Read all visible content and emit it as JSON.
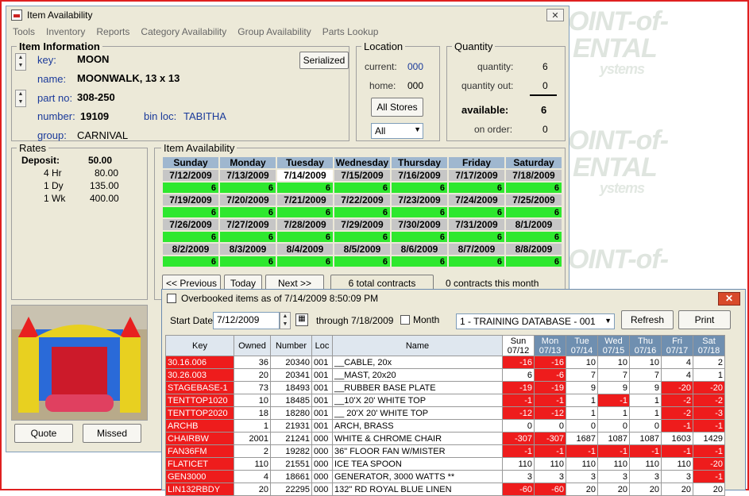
{
  "brand": {
    "lines": [
      "OINT-of-",
      "ENTAL",
      "ystems"
    ]
  },
  "main": {
    "title": "Item Availability",
    "menu": [
      "Tools",
      "Inventory",
      "Reports",
      "Category Availability",
      "Group Availability",
      "Parts Lookup"
    ],
    "item_info": {
      "title": "Item Information",
      "key_label": "key:",
      "key": "MOON",
      "name_label": "name:",
      "name": "MOONWALK, 13 x 13",
      "part_label": "part no:",
      "part": "308-250",
      "number_label": "number:",
      "number": "19109",
      "bin_label": "bin loc:",
      "bin": "TABITHA",
      "group_label": "group:",
      "group": "CARNIVAL",
      "serialized": "Serialized"
    },
    "location": {
      "title": "Location",
      "current_label": "current:",
      "current": "000",
      "home_label": "home:",
      "home": "000",
      "all_stores": "All Stores",
      "store_select": "All"
    },
    "quantity": {
      "title": "Quantity",
      "quantity_label": "quantity:",
      "quantity": "6",
      "out_label": "quantity out:",
      "out": "0",
      "available_label": "available:",
      "available": "6",
      "order_label": "on order:",
      "order": "0"
    },
    "rates": {
      "title": "Rates",
      "rows": [
        {
          "label": "Deposit:",
          "value": "50.00"
        },
        {
          "label": "4 Hr",
          "value": "80.00"
        },
        {
          "label": "1 Dy",
          "value": "135.00"
        },
        {
          "label": "1 Wk",
          "value": "400.00"
        }
      ]
    },
    "availability": {
      "title": "Item Availability",
      "days": [
        "Sunday",
        "Monday",
        "Tuesday",
        "Wednesday",
        "Thursday",
        "Friday",
        "Saturday"
      ],
      "weeks": [
        {
          "dates": [
            "7/12/2009",
            "7/13/2009",
            "7/14/2009",
            "7/15/2009",
            "7/16/2009",
            "7/17/2009",
            "7/18/2009"
          ],
          "counts": [
            "6",
            "6",
            "6",
            "6",
            "6",
            "6",
            "6"
          ]
        },
        {
          "dates": [
            "7/19/2009",
            "7/20/2009",
            "7/21/2009",
            "7/22/2009",
            "7/23/2009",
            "7/24/2009",
            "7/25/2009"
          ],
          "counts": [
            "6",
            "6",
            "6",
            "6",
            "6",
            "6",
            "6"
          ]
        },
        {
          "dates": [
            "7/26/2009",
            "7/27/2009",
            "7/28/2009",
            "7/29/2009",
            "7/30/2009",
            "7/31/2009",
            "8/1/2009"
          ],
          "counts": [
            "6",
            "6",
            "6",
            "6",
            "6",
            "6",
            "6"
          ]
        },
        {
          "dates": [
            "8/2/2009",
            "8/3/2009",
            "8/4/2009",
            "8/5/2009",
            "8/6/2009",
            "8/7/2009",
            "8/8/2009"
          ],
          "counts": [
            "6",
            "6",
            "6",
            "6",
            "6",
            "6",
            "6"
          ]
        }
      ],
      "prev": "<< Previous",
      "today": "Today",
      "next": "Next >>",
      "total_contracts": "6 total contracts",
      "month_contracts": "0 contracts this month"
    },
    "quote": "Quote",
    "missed": "Missed"
  },
  "overbooked": {
    "title": "Overbooked items as of 7/14/2009 8:50:09 PM",
    "start_label": "Start Date:",
    "start_date": "7/12/2009",
    "through": "through 7/18/2009",
    "month_label": "Month",
    "database": "1 - TRAINING DATABASE - 001",
    "refresh": "Refresh",
    "print": "Print",
    "headers": [
      "Key",
      "Owned",
      "Number",
      "Loc",
      "Name"
    ],
    "day_headers": [
      [
        "Sun",
        "07/12"
      ],
      [
        "Mon",
        "07/13"
      ],
      [
        "Tue",
        "07/14"
      ],
      [
        "Wed",
        "07/15"
      ],
      [
        "Thu",
        "07/16"
      ],
      [
        "Fri",
        "07/17"
      ],
      [
        "Sat",
        "07/18"
      ]
    ],
    "rows": [
      {
        "key": "30.16.006",
        "owned": "36",
        "number": "20340",
        "loc": "001",
        "name": "__CABLE, 20x",
        "days": [
          "-16",
          "-16",
          "10",
          "10",
          "10",
          "4",
          "2"
        ]
      },
      {
        "key": "30.26.003",
        "owned": "20",
        "number": "20341",
        "loc": "001",
        "name": "__MAST, 20x20",
        "days": [
          "6",
          "-6",
          "7",
          "7",
          "7",
          "4",
          "1"
        ]
      },
      {
        "key": "STAGEBASE-1",
        "owned": "73",
        "number": "18493",
        "loc": "001",
        "name": "__RUBBER BASE PLATE",
        "days": [
          "-19",
          "-19",
          "9",
          "9",
          "9",
          "-20",
          "-20"
        ]
      },
      {
        "key": "TENTTOP1020",
        "owned": "10",
        "number": "18485",
        "loc": "001",
        "name": "__10'X 20' WHITE TOP",
        "days": [
          "-1",
          "-1",
          "1",
          "-1",
          "1",
          "-2",
          "-2"
        ]
      },
      {
        "key": "TENTTOP2020",
        "owned": "18",
        "number": "18280",
        "loc": "001",
        "name": "__ 20'X 20' WHITE TOP",
        "days": [
          "-12",
          "-12",
          "1",
          "1",
          "1",
          "-2",
          "-3"
        ]
      },
      {
        "key": "ARCHB",
        "owned": "1",
        "number": "21931",
        "loc": "001",
        "name": "ARCH, BRASS",
        "days": [
          "0",
          "0",
          "0",
          "0",
          "0",
          "-1",
          "-1"
        ]
      },
      {
        "key": "CHAIRBW",
        "owned": "2001",
        "number": "21241",
        "loc": "000",
        "name": "WHITE & CHROME CHAIR",
        "days": [
          "-307",
          "-307",
          "1687",
          "1087",
          "1087",
          "1603",
          "1429"
        ]
      },
      {
        "key": "FAN36FM",
        "owned": "2",
        "number": "19282",
        "loc": "000",
        "name": "36\" FLOOR FAN W/MISTER",
        "days": [
          "-1",
          "-1",
          "-1",
          "-1",
          "-1",
          "-1",
          "-1"
        ]
      },
      {
        "key": "FLATICET",
        "owned": "110",
        "number": "21551",
        "loc": "000",
        "name": "ICE TEA SPOON",
        "days": [
          "110",
          "110",
          "110",
          "110",
          "110",
          "110",
          "-20"
        ]
      },
      {
        "key": "GEN3000",
        "owned": "4",
        "number": "18661",
        "loc": "000",
        "name": "GENERATOR, 3000 WATTS **",
        "days": [
          "3",
          "3",
          "3",
          "3",
          "3",
          "3",
          "-1"
        ]
      },
      {
        "key": "LIN132RBDY",
        "owned": "20",
        "number": "22295",
        "loc": "000",
        "name": "132\" RD ROYAL BLUE LINEN",
        "days": [
          "-60",
          "-60",
          "20",
          "20",
          "20",
          "20",
          "20"
        ]
      }
    ]
  }
}
